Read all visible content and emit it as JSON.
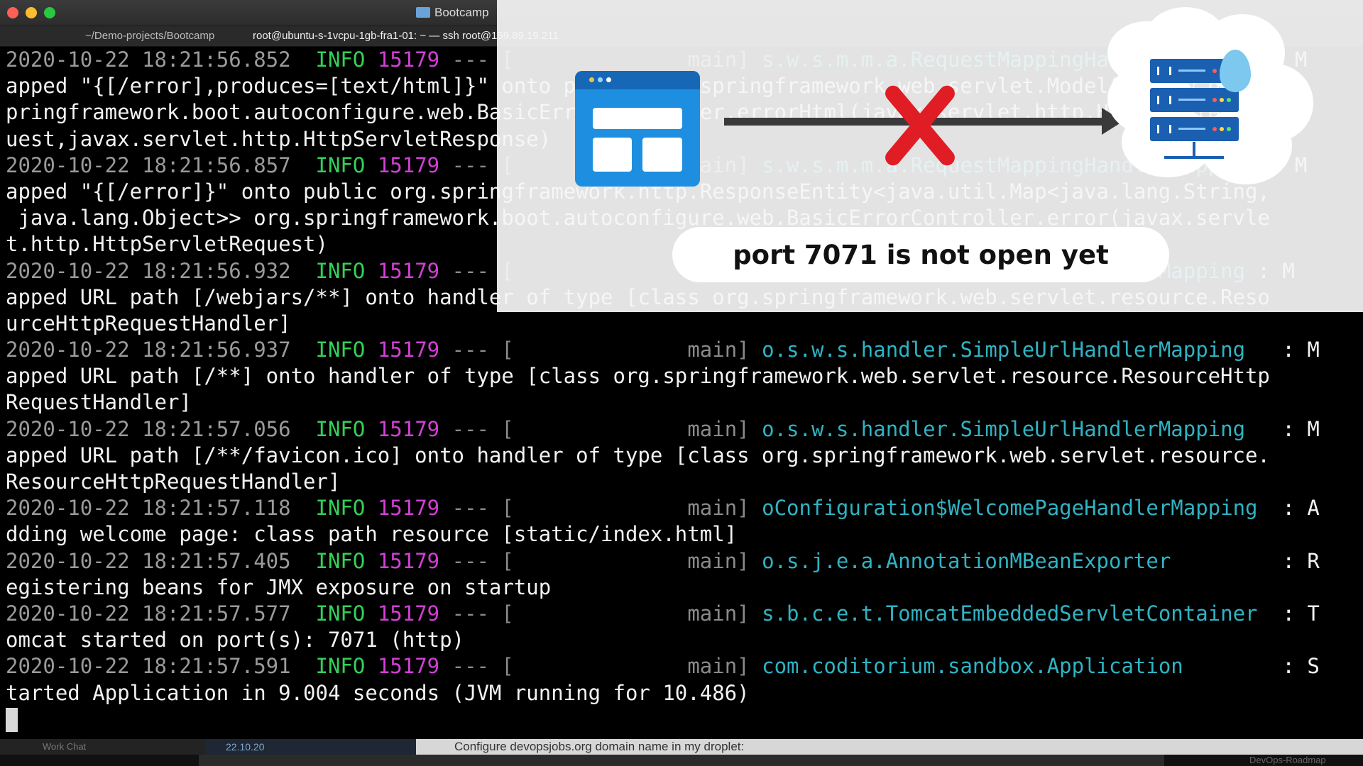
{
  "window": {
    "title": "Bootcamp",
    "tabs": [
      "~/Demo-projects/Bootcamp",
      "root@ubuntu-s-1vcpu-1gb-fra1-01: ~ — ssh root@159.89.19.211"
    ]
  },
  "terminal": {
    "lines": [
      {
        "ts": "2020-10-22 18:21:56.852",
        "level": "INFO",
        "pid": "15179",
        "sep": "--- [",
        "thread": "main]",
        "cls": "s.w.s.m.m.a.RequestMappingHandlerMapping",
        "tail": ": M"
      },
      {
        "text": "apped \"{[/error],produces=[text/html]}\" onto public org.springframework.web.servlet.ModelAndView org.s"
      },
      {
        "text": "pringframework.boot.autoconfigure.web.BasicErrorController.errorHtml(javax.servlet.http.HttpServletReq"
      },
      {
        "text": "uest,javax.servlet.http.HttpServletResponse)"
      },
      {
        "ts": "2020-10-22 18:21:56.857",
        "level": "INFO",
        "pid": "15179",
        "sep": "--- [",
        "thread": "main]",
        "cls": "s.w.s.m.m.a.RequestMappingHandlerMapping",
        "tail": ": M"
      },
      {
        "text": "apped \"{[/error]}\" onto public org.springframework.http.ResponseEntity<java.util.Map<java.lang.String,"
      },
      {
        "text": " java.lang.Object>> org.springframework.boot.autoconfigure.web.BasicErrorController.error(javax.servle"
      },
      {
        "text": "t.http.HttpServletRequest)"
      },
      {
        "ts": "2020-10-22 18:21:56.932",
        "level": "INFO",
        "pid": "15179",
        "sep": "--- [",
        "thread": "main]",
        "cls": "o.s.w.s.handler.SimpleUrlHandlerMapping",
        "tail": ": M"
      },
      {
        "text": "apped URL path [/webjars/**] onto handler of type [class org.springframework.web.servlet.resource.Reso"
      },
      {
        "text": "urceHttpRequestHandler]"
      },
      {
        "ts": "2020-10-22 18:21:56.937",
        "level": "INFO",
        "pid": "15179",
        "sep": "--- [",
        "thread": "main]",
        "cls": "o.s.w.s.handler.SimpleUrlHandlerMapping",
        "tail": "  : M"
      },
      {
        "text": "apped URL path [/**] onto handler of type [class org.springframework.web.servlet.resource.ResourceHttp"
      },
      {
        "text": "RequestHandler]"
      },
      {
        "ts": "2020-10-22 18:21:57.056",
        "level": "INFO",
        "pid": "15179",
        "sep": "--- [",
        "thread": "main]",
        "cls": "o.s.w.s.handler.SimpleUrlHandlerMapping",
        "tail": "  : M"
      },
      {
        "text": "apped URL path [/**/favicon.ico] onto handler of type [class org.springframework.web.servlet.resource."
      },
      {
        "text": "ResourceHttpRequestHandler]"
      },
      {
        "ts": "2020-10-22 18:21:57.118",
        "level": "INFO",
        "pid": "15179",
        "sep": "--- [",
        "thread": "main]",
        "cls": "oConfiguration$WelcomePageHandlerMapping",
        "tail": " : A"
      },
      {
        "text": "dding welcome page: class path resource [static/index.html]"
      },
      {
        "ts": "2020-10-22 18:21:57.405",
        "level": "INFO",
        "pid": "15179",
        "sep": "--- [",
        "thread": "main]",
        "cls": "o.s.j.e.a.AnnotationMBeanExporter",
        "tail": "        : R"
      },
      {
        "text": "egistering beans for JMX exposure on startup"
      },
      {
        "ts": "2020-10-22 18:21:57.577",
        "level": "INFO",
        "pid": "15179",
        "sep": "--- [",
        "thread": "main]",
        "cls": "s.b.c.e.t.TomcatEmbeddedServletContainer",
        "tail": " : T"
      },
      {
        "text": "omcat started on port(s): 7071 (http)"
      },
      {
        "ts": "2020-10-22 18:21:57.591",
        "level": "INFO",
        "pid": "15179",
        "sep": "--- [",
        "thread": "main]",
        "cls": "com.coditorium.sandbox.Application",
        "tail": "       : S"
      },
      {
        "text": "tarted Application in 9.004 seconds (JVM running for 10.486)"
      }
    ]
  },
  "overlay": {
    "message": "port 7071 is not open yet",
    "icons": [
      "browser-window-icon",
      "blocked-x-icon",
      "arrow-right-icon",
      "server-rack-icon",
      "cloud-icon"
    ],
    "colors": {
      "x": "#e01d25",
      "browser": "#1e8fe0",
      "server": "#1a5fb0"
    }
  },
  "statusbar": {
    "work_chat": "Work Chat",
    "date": "22.10.20",
    "task": "Configure devopsjobs.org domain name in my droplet:"
  },
  "dock": {
    "label": "DevOps-Roadmap"
  }
}
